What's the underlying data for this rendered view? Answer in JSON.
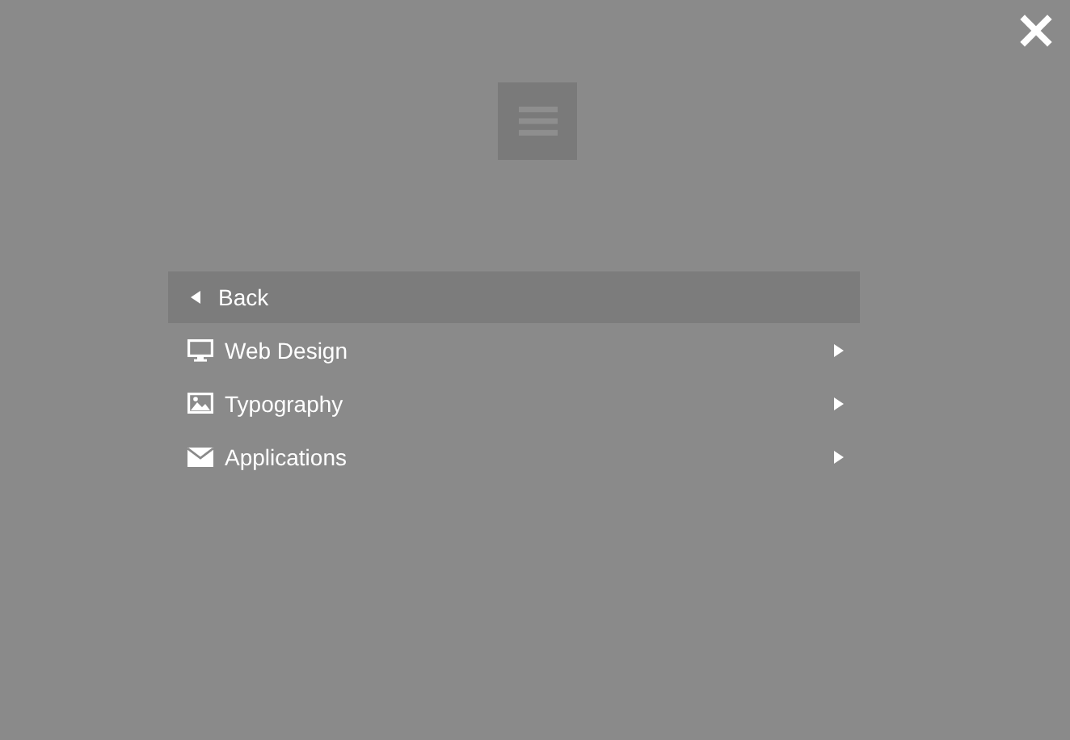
{
  "menu": {
    "items": [
      {
        "kind": "back",
        "label": "Back",
        "selected": true
      },
      {
        "kind": "submenu",
        "label": "Web Design",
        "selected": false
      },
      {
        "kind": "submenu",
        "label": "Typography",
        "selected": false
      },
      {
        "kind": "submenu",
        "label": "Applications",
        "selected": false
      }
    ]
  }
}
